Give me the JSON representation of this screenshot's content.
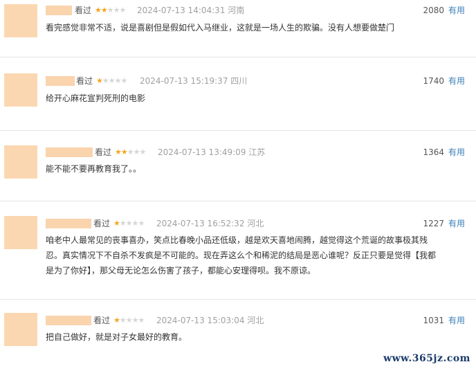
{
  "reviews": [
    {
      "watched": "看过",
      "stars": 2,
      "date": "2024-07-13 14:04:31",
      "region": "河南",
      "votes": "2080",
      "useful": "有用",
      "text": "看完感觉非常不适，说是喜剧但是假如代入马继业，这就是一场人生的欺骗。没有人想要做楚门"
    },
    {
      "watched": "看过",
      "stars": 1,
      "date": "2024-07-13 15:19:37",
      "region": "四川",
      "votes": "1740",
      "useful": "有用",
      "text": "给开心麻花宣判死刑的电影"
    },
    {
      "watched": "看过",
      "stars": 2,
      "date": "2024-07-13 13:49:09",
      "region": "江苏",
      "votes": "1364",
      "useful": "有用",
      "text": "能不能不要再教育我了。。"
    },
    {
      "watched": "看过",
      "stars": 1,
      "date": "2024-07-13 16:52:32",
      "region": "河北",
      "votes": "1227",
      "useful": "有用",
      "text_lines": [
        "咱老中人最常见的丧事喜办，笑点比春晚小品还低级，越是欢天喜地闹腾，越觉得这个荒诞的故事极其残",
        "忍。真实情况下不自杀不发疯是不可能的。现在弄这么个和稀泥的结局是恶心谁呢？反正只要是觉得【我都",
        "是为了你好】，那父母无论怎么伤害了孩子，都能心安理得呗。我不原谅。"
      ]
    },
    {
      "watched": "看过",
      "stars": 1,
      "date": "2024-07-13 15:03:04",
      "region": "河北",
      "votes": "1031",
      "useful": "有用",
      "text": "把自己做好，就是对子女最好的教育。"
    }
  ],
  "watermark": "www.365jz.com",
  "colors": {
    "star_on": "#f5a623",
    "star_off": "#d6d6d6",
    "useful_link": "#3a7fb8",
    "avatar_placeholder": "#fbd7b1"
  }
}
